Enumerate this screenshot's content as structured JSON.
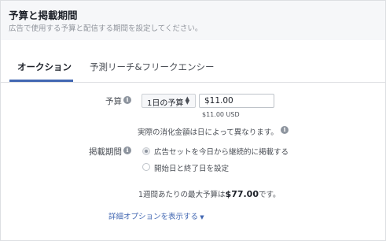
{
  "header": {
    "title": "予算と掲載期間",
    "subtitle": "広告で使用する予算と配信する期間を設定してください。"
  },
  "tabs": [
    {
      "label": "オークション",
      "active": true
    },
    {
      "label": "予測リーチ&フリークエンシー",
      "active": false
    }
  ],
  "budget": {
    "label": "予算",
    "select_value": "1日の予算",
    "amount": "$11.00",
    "usd_note": "$11.00 USD",
    "notice": "実際の消化金額は日によって異なります。"
  },
  "schedule": {
    "label": "掲載期間",
    "options": [
      {
        "label": "広告セットを今日から継続的に掲載する",
        "checked": true
      },
      {
        "label": "開始日と終了日を設定",
        "checked": false
      }
    ]
  },
  "weekly": {
    "prefix": "1週間あたりの最大予算は",
    "amount": "$77.00",
    "suffix": "です。"
  },
  "advanced_link": "詳細オプションを表示する",
  "icons": {
    "info": "info-icon",
    "caret": "caret-down-icon",
    "sort": "sort-arrows-icon"
  },
  "colors": {
    "accent": "#4267b2",
    "header_bg": "#f6f7f9",
    "border": "#dddfe2"
  }
}
